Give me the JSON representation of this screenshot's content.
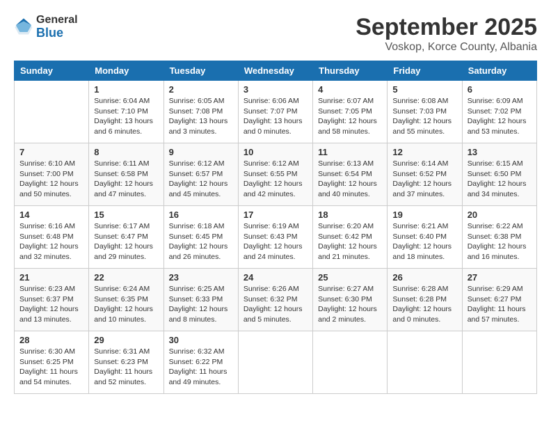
{
  "header": {
    "logo_general": "General",
    "logo_blue": "Blue",
    "month": "September 2025",
    "location": "Voskop, Korce County, Albania"
  },
  "days_of_week": [
    "Sunday",
    "Monday",
    "Tuesday",
    "Wednesday",
    "Thursday",
    "Friday",
    "Saturday"
  ],
  "weeks": [
    [
      {
        "day": "",
        "sunrise": "",
        "sunset": "",
        "daylight": ""
      },
      {
        "day": "1",
        "sunrise": "Sunrise: 6:04 AM",
        "sunset": "Sunset: 7:10 PM",
        "daylight": "Daylight: 13 hours and 6 minutes."
      },
      {
        "day": "2",
        "sunrise": "Sunrise: 6:05 AM",
        "sunset": "Sunset: 7:08 PM",
        "daylight": "Daylight: 13 hours and 3 minutes."
      },
      {
        "day": "3",
        "sunrise": "Sunrise: 6:06 AM",
        "sunset": "Sunset: 7:07 PM",
        "daylight": "Daylight: 13 hours and 0 minutes."
      },
      {
        "day": "4",
        "sunrise": "Sunrise: 6:07 AM",
        "sunset": "Sunset: 7:05 PM",
        "daylight": "Daylight: 12 hours and 58 minutes."
      },
      {
        "day": "5",
        "sunrise": "Sunrise: 6:08 AM",
        "sunset": "Sunset: 7:03 PM",
        "daylight": "Daylight: 12 hours and 55 minutes."
      },
      {
        "day": "6",
        "sunrise": "Sunrise: 6:09 AM",
        "sunset": "Sunset: 7:02 PM",
        "daylight": "Daylight: 12 hours and 53 minutes."
      }
    ],
    [
      {
        "day": "7",
        "sunrise": "Sunrise: 6:10 AM",
        "sunset": "Sunset: 7:00 PM",
        "daylight": "Daylight: 12 hours and 50 minutes."
      },
      {
        "day": "8",
        "sunrise": "Sunrise: 6:11 AM",
        "sunset": "Sunset: 6:58 PM",
        "daylight": "Daylight: 12 hours and 47 minutes."
      },
      {
        "day": "9",
        "sunrise": "Sunrise: 6:12 AM",
        "sunset": "Sunset: 6:57 PM",
        "daylight": "Daylight: 12 hours and 45 minutes."
      },
      {
        "day": "10",
        "sunrise": "Sunrise: 6:12 AM",
        "sunset": "Sunset: 6:55 PM",
        "daylight": "Daylight: 12 hours and 42 minutes."
      },
      {
        "day": "11",
        "sunrise": "Sunrise: 6:13 AM",
        "sunset": "Sunset: 6:54 PM",
        "daylight": "Daylight: 12 hours and 40 minutes."
      },
      {
        "day": "12",
        "sunrise": "Sunrise: 6:14 AM",
        "sunset": "Sunset: 6:52 PM",
        "daylight": "Daylight: 12 hours and 37 minutes."
      },
      {
        "day": "13",
        "sunrise": "Sunrise: 6:15 AM",
        "sunset": "Sunset: 6:50 PM",
        "daylight": "Daylight: 12 hours and 34 minutes."
      }
    ],
    [
      {
        "day": "14",
        "sunrise": "Sunrise: 6:16 AM",
        "sunset": "Sunset: 6:48 PM",
        "daylight": "Daylight: 12 hours and 32 minutes."
      },
      {
        "day": "15",
        "sunrise": "Sunrise: 6:17 AM",
        "sunset": "Sunset: 6:47 PM",
        "daylight": "Daylight: 12 hours and 29 minutes."
      },
      {
        "day": "16",
        "sunrise": "Sunrise: 6:18 AM",
        "sunset": "Sunset: 6:45 PM",
        "daylight": "Daylight: 12 hours and 26 minutes."
      },
      {
        "day": "17",
        "sunrise": "Sunrise: 6:19 AM",
        "sunset": "Sunset: 6:43 PM",
        "daylight": "Daylight: 12 hours and 24 minutes."
      },
      {
        "day": "18",
        "sunrise": "Sunrise: 6:20 AM",
        "sunset": "Sunset: 6:42 PM",
        "daylight": "Daylight: 12 hours and 21 minutes."
      },
      {
        "day": "19",
        "sunrise": "Sunrise: 6:21 AM",
        "sunset": "Sunset: 6:40 PM",
        "daylight": "Daylight: 12 hours and 18 minutes."
      },
      {
        "day": "20",
        "sunrise": "Sunrise: 6:22 AM",
        "sunset": "Sunset: 6:38 PM",
        "daylight": "Daylight: 12 hours and 16 minutes."
      }
    ],
    [
      {
        "day": "21",
        "sunrise": "Sunrise: 6:23 AM",
        "sunset": "Sunset: 6:37 PM",
        "daylight": "Daylight: 12 hours and 13 minutes."
      },
      {
        "day": "22",
        "sunrise": "Sunrise: 6:24 AM",
        "sunset": "Sunset: 6:35 PM",
        "daylight": "Daylight: 12 hours and 10 minutes."
      },
      {
        "day": "23",
        "sunrise": "Sunrise: 6:25 AM",
        "sunset": "Sunset: 6:33 PM",
        "daylight": "Daylight: 12 hours and 8 minutes."
      },
      {
        "day": "24",
        "sunrise": "Sunrise: 6:26 AM",
        "sunset": "Sunset: 6:32 PM",
        "daylight": "Daylight: 12 hours and 5 minutes."
      },
      {
        "day": "25",
        "sunrise": "Sunrise: 6:27 AM",
        "sunset": "Sunset: 6:30 PM",
        "daylight": "Daylight: 12 hours and 2 minutes."
      },
      {
        "day": "26",
        "sunrise": "Sunrise: 6:28 AM",
        "sunset": "Sunset: 6:28 PM",
        "daylight": "Daylight: 12 hours and 0 minutes."
      },
      {
        "day": "27",
        "sunrise": "Sunrise: 6:29 AM",
        "sunset": "Sunset: 6:27 PM",
        "daylight": "Daylight: 11 hours and 57 minutes."
      }
    ],
    [
      {
        "day": "28",
        "sunrise": "Sunrise: 6:30 AM",
        "sunset": "Sunset: 6:25 PM",
        "daylight": "Daylight: 11 hours and 54 minutes."
      },
      {
        "day": "29",
        "sunrise": "Sunrise: 6:31 AM",
        "sunset": "Sunset: 6:23 PM",
        "daylight": "Daylight: 11 hours and 52 minutes."
      },
      {
        "day": "30",
        "sunrise": "Sunrise: 6:32 AM",
        "sunset": "Sunset: 6:22 PM",
        "daylight": "Daylight: 11 hours and 49 minutes."
      },
      {
        "day": "",
        "sunrise": "",
        "sunset": "",
        "daylight": ""
      },
      {
        "day": "",
        "sunrise": "",
        "sunset": "",
        "daylight": ""
      },
      {
        "day": "",
        "sunrise": "",
        "sunset": "",
        "daylight": ""
      },
      {
        "day": "",
        "sunrise": "",
        "sunset": "",
        "daylight": ""
      }
    ]
  ]
}
